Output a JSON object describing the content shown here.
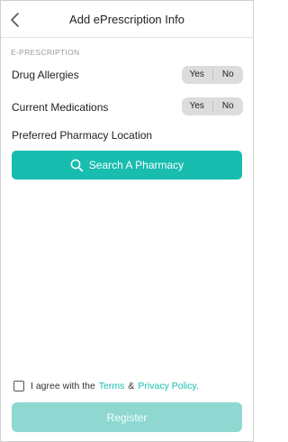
{
  "header": {
    "title": "Add ePrescription Info",
    "back_icon": "chevron-left-icon"
  },
  "section": {
    "label": "E-PRESCRIPTION"
  },
  "rows": [
    {
      "label": "Drug Allergies",
      "yes": "Yes",
      "no": "No"
    },
    {
      "label": "Current Medications",
      "yes": "Yes",
      "no": "No"
    }
  ],
  "pharmacy": {
    "label": "Preferred Pharmacy Location",
    "search_button_label": "Search A Pharmacy",
    "search_icon": "search-icon"
  },
  "agreement": {
    "prefix": "I agree with the",
    "terms_label": "Terms",
    "ampersand": "&",
    "privacy_label": "Privacy Policy."
  },
  "register": {
    "label": "Register"
  },
  "colors": {
    "accent": "#18bdb0",
    "accent_disabled": "#8ed8d1",
    "toggle_bg": "#dcdcdc"
  }
}
